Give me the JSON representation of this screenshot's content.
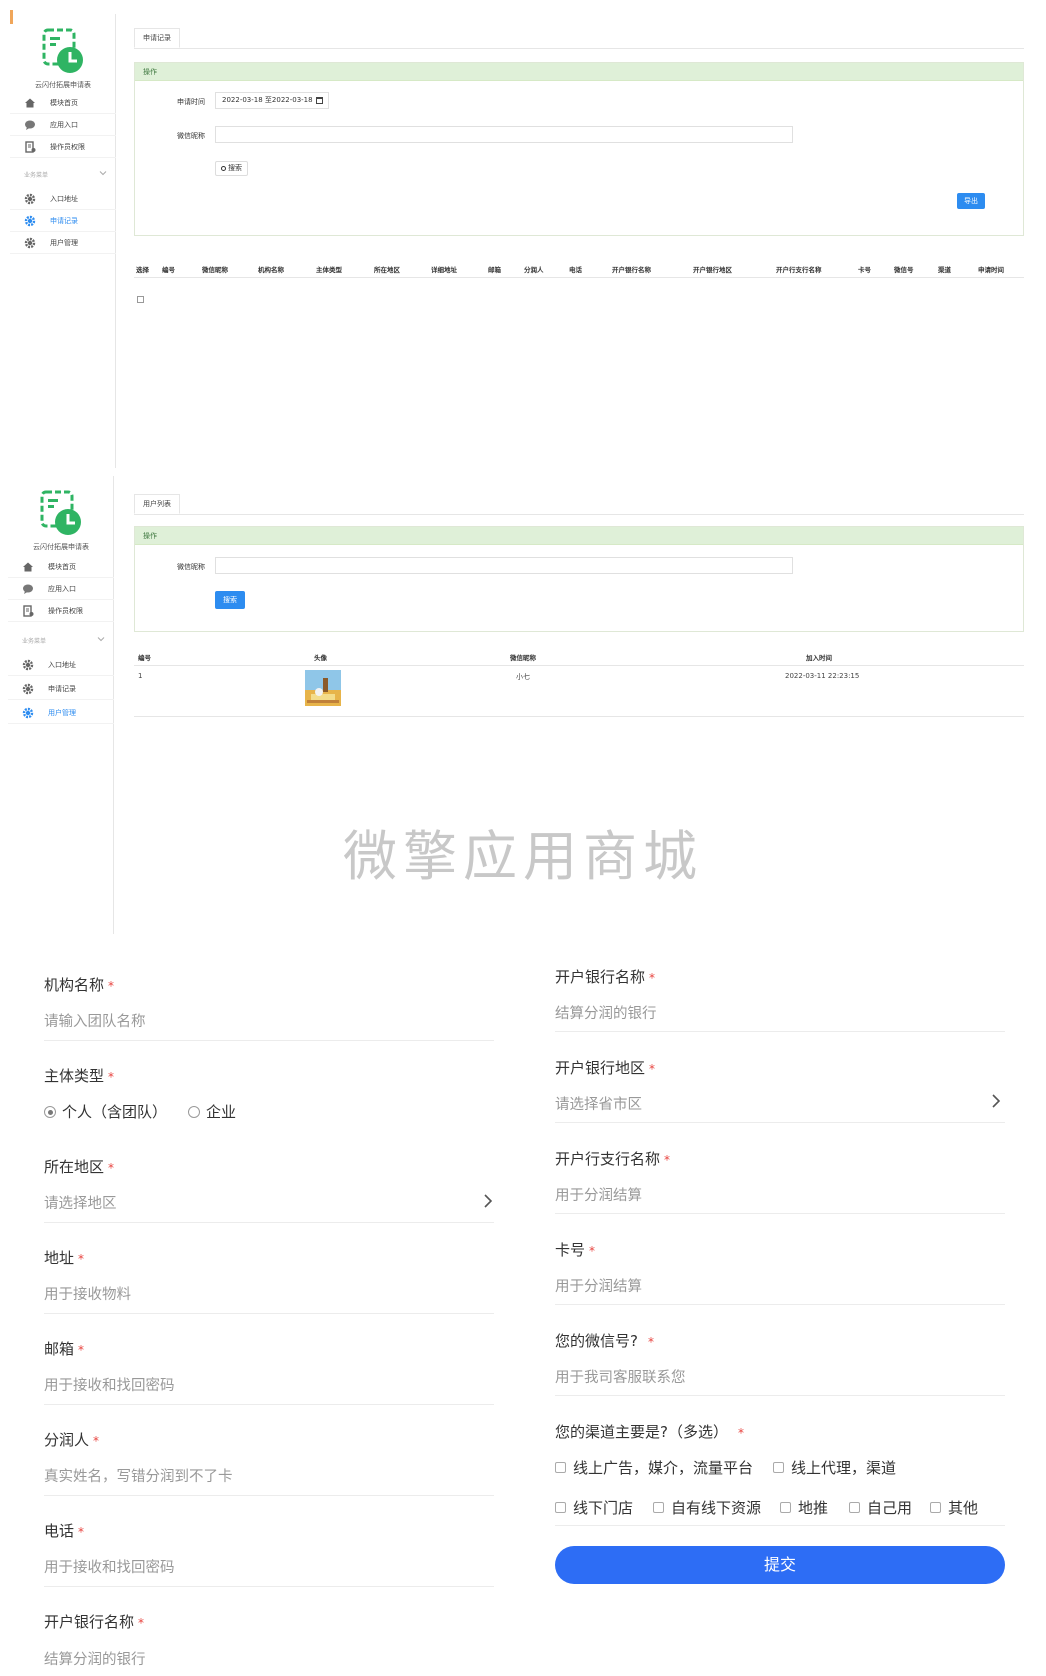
{
  "sidebar": {
    "app_title": "云闪付拓展申请表",
    "items": [
      {
        "label": "模块首页",
        "icon": "home-icon"
      },
      {
        "label": "应用入口",
        "icon": "chat-icon"
      },
      {
        "label": "操作员权限",
        "icon": "doc-icon"
      }
    ],
    "group_label": "业务菜单",
    "group_items": [
      {
        "label": "入口地址",
        "icon": "gear-icon"
      },
      {
        "label": "申请记录",
        "icon": "gear-icon"
      },
      {
        "label": "用户管理",
        "icon": "gear-icon"
      }
    ]
  },
  "panel1": {
    "tab_label": "申请记录",
    "op_title": "操作",
    "date_label": "申请时间",
    "date_value": "2022-03-18 至2022-03-18",
    "wechat_label": "微信昵称",
    "wechat_value": "",
    "search_button": "搜索",
    "export_button": "导出",
    "columns": [
      "选择",
      "编号",
      "微信昵称",
      "机构名称",
      "主体类型",
      "所在地区",
      "详细地址",
      "邮箱",
      "分润人",
      "电话",
      "开户银行名称",
      "开户银行地区",
      "开户行支行名称",
      "卡号",
      "微信号",
      "渠道",
      "申请时间"
    ]
  },
  "panel2": {
    "tab_label": "用户列表",
    "op_title": "操作",
    "wechat_label": "微信昵称",
    "wechat_value": "",
    "search_button": "搜索",
    "columns": [
      "编号",
      "头像",
      "微信昵称",
      "加入时间"
    ],
    "rows": [
      {
        "id": "1",
        "nickname": "小七",
        "joined": "2022-03-11 22:23:15"
      }
    ]
  },
  "watermark": "微擎应用商城",
  "form_left": {
    "org_name": {
      "label": "机构名称",
      "placeholder": "请输入团队名称"
    },
    "entity_type": {
      "label": "主体类型",
      "options": [
        "个人（含团队）",
        "企业"
      ],
      "selected": "个人（含团队）"
    },
    "region": {
      "label": "所在地区",
      "placeholder": "请选择地区"
    },
    "address": {
      "label": "地址",
      "placeholder": "用于接收物料"
    },
    "email": {
      "label": "邮箱",
      "placeholder": "用于接收和找回密码"
    },
    "profit_person": {
      "label": "分润人",
      "placeholder": "真实姓名，写错分润到不了卡"
    },
    "phone": {
      "label": "电话",
      "placeholder": "用于接收和找回密码"
    },
    "bank_name": {
      "label": "开户银行名称",
      "placeholder": "结算分润的银行"
    }
  },
  "form_right": {
    "bank_name": {
      "label": "开户银行名称",
      "placeholder": "结算分润的银行"
    },
    "bank_region": {
      "label": "开户银行地区",
      "placeholder": "请选择省市区"
    },
    "branch_name": {
      "label": "开户行支行名称",
      "placeholder": "用于分润结算"
    },
    "card_no": {
      "label": "卡号",
      "placeholder": "用于分润结算"
    },
    "wechat_id": {
      "label": "您的微信号?",
      "placeholder": "用于我司客服联系您"
    },
    "channels": {
      "label": "您的渠道主要是?（多选）",
      "options": [
        "线上广告，媒介，流量平台",
        "线上代理，渠道",
        "线下门店",
        "自有线下资源",
        "地推",
        "自己用",
        "其他"
      ]
    },
    "submit": "提交"
  },
  "required_mark": "*",
  "colors": {
    "primary": "#2d8cf0",
    "submit": "#2d6df5",
    "op_header": "#dff0d8",
    "required": "#e8443f",
    "logo_green": "#2fb463"
  }
}
